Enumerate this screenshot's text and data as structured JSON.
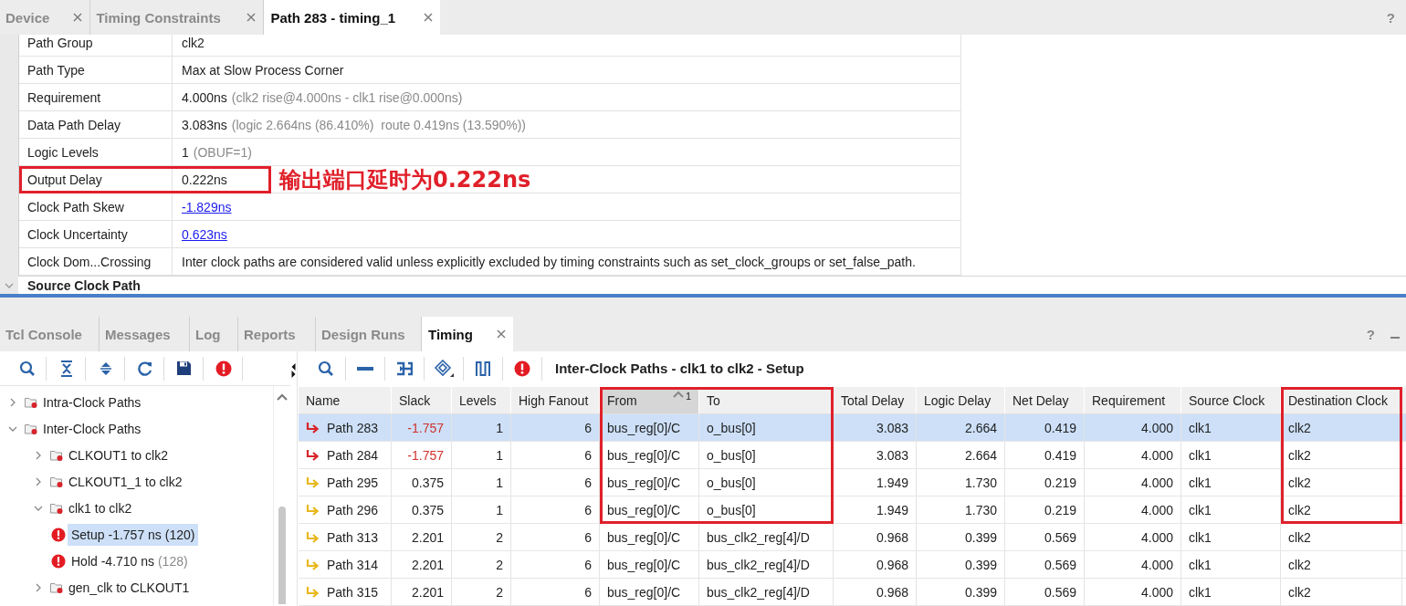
{
  "editor_tabs": [
    {
      "label": "Device",
      "selected": false,
      "closable": true
    },
    {
      "label": "Timing Constraints",
      "selected": false,
      "closable": true
    },
    {
      "label": "Path 283 - timing_1",
      "selected": true,
      "closable": true
    }
  ],
  "editor_help": "?",
  "properties": [
    {
      "label": "Path Group",
      "value": "clk2",
      "kind": "text",
      "highlighted": false
    },
    {
      "label": "Path Type",
      "value": "Max at Slow Process Corner",
      "kind": "text",
      "highlighted": false
    },
    {
      "label": "Requirement",
      "value": "4.000ns",
      "note": "(clk2 rise@4.000ns - clk1 rise@0.000ns)",
      "kind": "text",
      "highlighted": false
    },
    {
      "label": "Data Path Delay",
      "value": "3.083ns",
      "note": "(logic 2.664ns (86.410%)  route 0.419ns (13.590%))",
      "kind": "text",
      "highlighted": false
    },
    {
      "label": "Logic Levels",
      "value": "1",
      "note": "(OBUF=1)",
      "kind": "text",
      "highlighted": false
    },
    {
      "label": "Output Delay",
      "value": "0.222ns",
      "kind": "text",
      "highlighted": true,
      "callout": "输出端口延时为0.222ns"
    },
    {
      "label": "Clock Path Skew",
      "value": "-1.829ns",
      "kind": "link",
      "highlighted": false
    },
    {
      "label": "Clock Uncertainty",
      "value": "0.623ns",
      "kind": "link",
      "highlighted": false
    },
    {
      "label": "Clock Dom...Crossing",
      "value": "Inter clock paths are considered valid unless explicitly excluded by timing constraints such as set_clock_groups or set_false_path.",
      "kind": "text",
      "highlighted": false
    }
  ],
  "section_header": {
    "label": "Source Clock Path",
    "expanded": true
  },
  "bottom_tabs": [
    {
      "label": "Tcl Console",
      "selected": false,
      "closable": false
    },
    {
      "label": "Messages",
      "selected": false,
      "closable": false
    },
    {
      "label": "Log",
      "selected": false,
      "closable": false
    },
    {
      "label": "Reports",
      "selected": false,
      "closable": false
    },
    {
      "label": "Design Runs",
      "selected": false,
      "closable": false
    },
    {
      "label": "Timing",
      "selected": true,
      "closable": true
    }
  ],
  "bottom_help": "?",
  "tree": [
    {
      "label": "Intra-Clock Paths",
      "kind": "folder",
      "expanded": false,
      "selected": false
    },
    {
      "label": "Inter-Clock Paths",
      "kind": "folder",
      "expanded": true,
      "selected": false,
      "children": [
        {
          "label": "CLKOUT1 to clk2",
          "kind": "folder",
          "expanded": false,
          "selected": false
        },
        {
          "label": "CLKOUT1_1 to clk2",
          "kind": "folder",
          "expanded": false,
          "selected": false
        },
        {
          "label": "clk1 to clk2",
          "kind": "folder",
          "expanded": true,
          "selected": false,
          "children": [
            {
              "label": "Setup -1.757 ns",
              "count": "(120)",
              "kind": "error",
              "selected": true
            },
            {
              "label": "Hold -4.710 ns",
              "count": "(128)",
              "kind": "error",
              "selected": false
            }
          ]
        },
        {
          "label": "gen_clk to CLKOUT1",
          "kind": "folder",
          "expanded": false,
          "selected": false
        }
      ]
    }
  ],
  "report": {
    "title": "Inter-Clock Paths - clk1 to clk2 - Setup",
    "columns": [
      {
        "label": "Name",
        "kind": "name",
        "sorted": false,
        "boxed": false
      },
      {
        "label": "Slack",
        "kind": "number",
        "sorted": false,
        "boxed": false
      },
      {
        "label": "Levels",
        "kind": "number",
        "sorted": false,
        "boxed": false
      },
      {
        "label": "High Fanout",
        "kind": "number",
        "sorted": false,
        "boxed": false
      },
      {
        "label": "From",
        "kind": "text",
        "sorted": true,
        "sort_rank": "1",
        "boxed": true
      },
      {
        "label": "To",
        "kind": "text",
        "sorted": false,
        "boxed": true
      },
      {
        "label": "Total Delay",
        "kind": "number",
        "sorted": false,
        "boxed": false
      },
      {
        "label": "Logic Delay",
        "kind": "number",
        "sorted": false,
        "boxed": false
      },
      {
        "label": "Net Delay",
        "kind": "number",
        "sorted": false,
        "boxed": false
      },
      {
        "label": "Requirement",
        "kind": "number",
        "sorted": false,
        "boxed": false
      },
      {
        "label": "Source Clock",
        "kind": "text",
        "sorted": false,
        "boxed": false
      },
      {
        "label": "Destination Clock",
        "kind": "text",
        "sorted": false,
        "boxed": true
      }
    ],
    "rows": [
      {
        "cells": [
          "Path 283",
          "-1.757",
          "1",
          "6",
          "bus_reg[0]/C",
          "o_bus[0]",
          "3.083",
          "2.664",
          "0.419",
          "4.000",
          "clk1",
          "clk2"
        ],
        "selected": true,
        "failing": true,
        "boxed": true
      },
      {
        "cells": [
          "Path 284",
          "-1.757",
          "1",
          "6",
          "bus_reg[0]/C",
          "o_bus[0]",
          "3.083",
          "2.664",
          "0.419",
          "4.000",
          "clk1",
          "clk2"
        ],
        "selected": false,
        "failing": true,
        "boxed": true
      },
      {
        "cells": [
          "Path 295",
          "0.375",
          "1",
          "6",
          "bus_reg[0]/C",
          "o_bus[0]",
          "1.949",
          "1.730",
          "0.219",
          "4.000",
          "clk1",
          "clk2"
        ],
        "selected": false,
        "failing": false,
        "boxed": true
      },
      {
        "cells": [
          "Path 296",
          "0.375",
          "1",
          "6",
          "bus_reg[0]/C",
          "o_bus[0]",
          "1.949",
          "1.730",
          "0.219",
          "4.000",
          "clk1",
          "clk2"
        ],
        "selected": false,
        "failing": false,
        "boxed": true
      },
      {
        "cells": [
          "Path 313",
          "2.201",
          "2",
          "6",
          "bus_reg[0]/C",
          "bus_clk2_reg[4]/D",
          "0.968",
          "0.399",
          "0.569",
          "4.000",
          "clk1",
          "clk2"
        ],
        "selected": false,
        "failing": false,
        "boxed": false
      },
      {
        "cells": [
          "Path 314",
          "2.201",
          "2",
          "6",
          "bus_reg[0]/C",
          "bus_clk2_reg[4]/D",
          "0.968",
          "0.399",
          "0.569",
          "4.000",
          "clk1",
          "clk2"
        ],
        "selected": false,
        "failing": false,
        "boxed": false
      },
      {
        "cells": [
          "Path 315",
          "2.201",
          "2",
          "6",
          "bus_reg[0]/C",
          "bus_clk2_reg[4]/D",
          "0.968",
          "0.399",
          "0.569",
          "4.000",
          "clk1",
          "clk2"
        ],
        "selected": false,
        "failing": false,
        "boxed": false
      }
    ]
  }
}
